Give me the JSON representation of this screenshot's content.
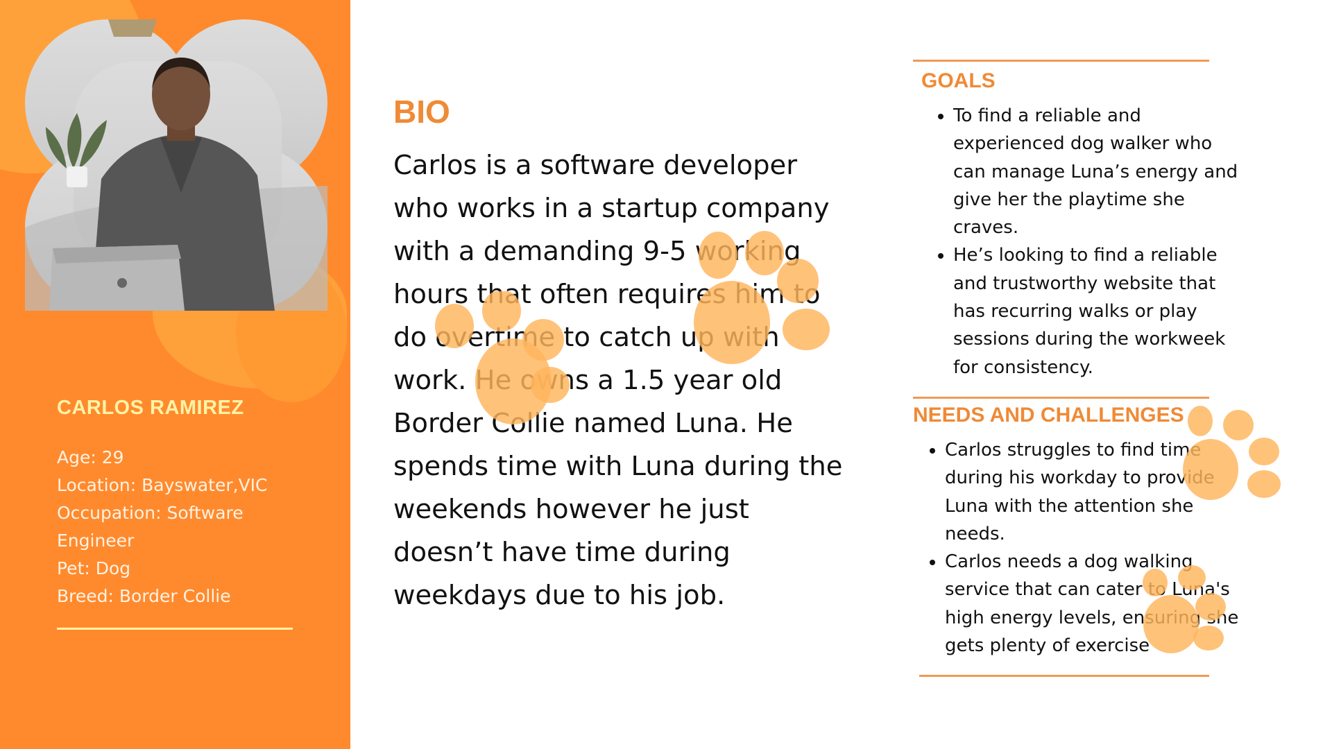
{
  "profile": {
    "name": "CARLOS RAMIREZ",
    "age": "Age: 29",
    "location": "Location: Bayswater,VIC",
    "occupation_line1": "Occupation: Software",
    "occupation_line2": "Engineer",
    "pet": "Pet: Dog",
    "breed": "Breed: Border Collie"
  },
  "bio": {
    "title": "BIO",
    "text": "Carlos is a software developer who works in a startup company with a demanding 9-5 working hours that often requires him to do overtime to catch up with work. He owns a 1.5 year old Border Collie named Luna. He spends time with Luna during the weekends however he just doesn’t have time during weekdays due to his job."
  },
  "goals": {
    "title": "GOALS",
    "items": [
      "To find a reliable and experienced dog walker who can manage Luna’s energy and give her the playtime she craves.",
      "He’s looking to find a reliable and trustworthy website that has recurring walks or play sessions during the workweek for consistency."
    ]
  },
  "needs": {
    "title": "NEEDS AND CHALLENGES",
    "items": [
      "Carlos struggles to find time during his workday to provide Luna with the attention she needs.",
      "Carlos needs a dog walking service that can cater to Luna's high energy levels, ensuring she gets plenty of exercise"
    ]
  },
  "colors": {
    "panel": "#ff8a2d",
    "accent": "#ef8a36",
    "name": "#fff3a6",
    "paw": "#ffb45c"
  }
}
